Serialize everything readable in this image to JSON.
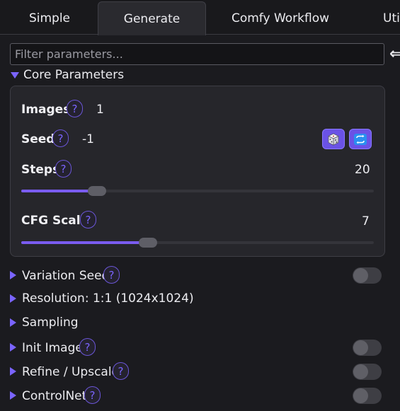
{
  "tabs": [
    {
      "label": "Simple",
      "active": false
    },
    {
      "label": "Generate",
      "active": true
    },
    {
      "label": "Comfy Workflow",
      "active": false
    },
    {
      "label": "Uti",
      "active": false
    }
  ],
  "filter": {
    "placeholder": "Filter parameters...",
    "value": ""
  },
  "side_arrow_icon": "collapse-left-icon",
  "core": {
    "label": "Core Parameters",
    "expanded": true,
    "images": {
      "label": "Images",
      "help": "?",
      "value": "1"
    },
    "seed": {
      "label": "Seed",
      "help": "?",
      "value": "-1",
      "random_icon": "dice-icon",
      "reuse_icon": "recycle-icon"
    },
    "steps": {
      "label": "Steps",
      "help": "?",
      "value": "20",
      "fraction": 0.215
    },
    "cfg": {
      "label": "CFG Scale",
      "help": "?",
      "value": "7",
      "fraction": 0.36
    }
  },
  "sections": [
    {
      "label": "Variation Seed",
      "help": "?",
      "toggle": false
    },
    {
      "label": "Resolution: 1:1 (1024x1024)"
    },
    {
      "label": "Sampling"
    },
    {
      "label": "Init Image",
      "help": "?",
      "toggle": false
    },
    {
      "label": "Refine / Upscale",
      "help": "?",
      "toggle": false
    },
    {
      "label": "ControlNet",
      "help": "?",
      "toggle": false
    }
  ],
  "colors": {
    "accent": "#7a64ff",
    "accent_fill": "#7a5cf0",
    "background": "#1b1b1f",
    "panel": "#26262b"
  }
}
